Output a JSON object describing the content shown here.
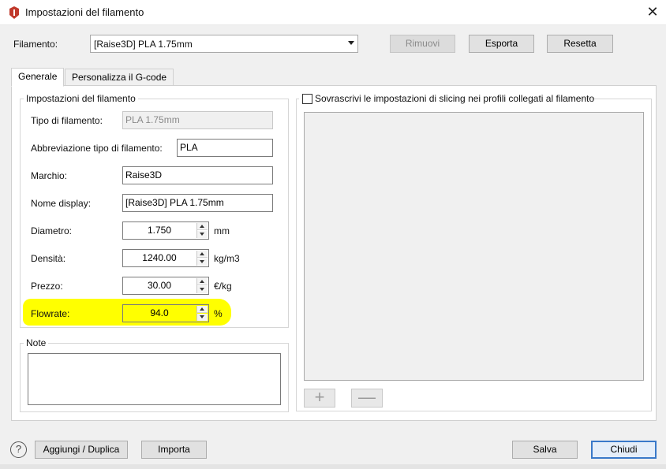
{
  "window": {
    "title": "Impostazioni del filamento",
    "close_glyph": "✕"
  },
  "header": {
    "filament_label": "Filamento:",
    "filament_selected": "[Raise3D] PLA 1.75mm",
    "remove_label": "Rimuovi",
    "export_label": "Esporta",
    "reset_label": "Resetta"
  },
  "tabs": [
    {
      "label": "Generale",
      "active": true
    },
    {
      "label": "Personalizza il G-code",
      "active": false
    }
  ],
  "settings_group": {
    "title": "Impostazioni del filamento",
    "type_label": "Tipo di filamento:",
    "type_value": "PLA 1.75mm",
    "abbrev_label": "Abbreviazione tipo di filamento:",
    "abbrev_value": "PLA",
    "brand_label": "Marchio:",
    "brand_value": "Raise3D",
    "display_label": "Nome display:",
    "display_value": "[Raise3D] PLA 1.75mm",
    "diameter_label": "Diametro:",
    "diameter_value": "1.750",
    "diameter_unit": "mm",
    "density_label": "Densità:",
    "density_value": "1240.00",
    "density_unit": "kg/m3",
    "price_label": "Prezzo:",
    "price_value": "30.00",
    "price_unit": "€/kg",
    "flowrate_label": "Flowrate:",
    "flowrate_value": "94.0",
    "flowrate_unit": "%"
  },
  "notes_group": {
    "title": "Note",
    "value": ""
  },
  "override": {
    "checkbox_label": "Sovrascrivi le impostazioni di slicing nei profili collegati al filamento",
    "checked": false,
    "add_glyph": "+",
    "remove_glyph": "—"
  },
  "footer": {
    "help_glyph": "?",
    "add_duplicate_label": "Aggiungi / Duplica",
    "import_label": "Importa",
    "save_label": "Salva",
    "close_label": "Chiudi"
  },
  "colors": {
    "highlight": "#ffff00",
    "app_icon": "#c0392b",
    "default_button_border": "#3a79c9"
  },
  "icons": [
    "app-logo-icon",
    "close-icon",
    "dropdown-arrow-icon",
    "spin-up-icon",
    "spin-down-icon",
    "plus-icon",
    "minus-icon",
    "help-icon"
  ]
}
